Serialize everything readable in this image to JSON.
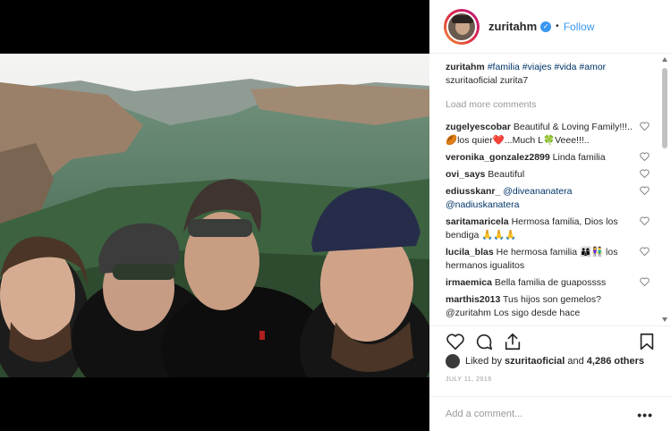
{
  "post": {
    "username": "zuritahm",
    "follow_label": "Follow",
    "dot": "•",
    "verified_mark": "✓",
    "photo_alt": "Family selfie at a mountain overlook"
  },
  "caption": {
    "username": "zuritahm",
    "tags": "#familia #viajes #vida #amor",
    "text": "szuritaoficial zurita7"
  },
  "load_more": "Load more comments",
  "comments": [
    {
      "username": "zugelyescobar",
      "text": "Beautiful & Loving Family!!!..🏉los quier❤️...Much L🍀Veee!!!.."
    },
    {
      "username": "veronika_gonzalez2899",
      "text": "Linda familia"
    },
    {
      "username": "ovi_says",
      "text": "Beautiful"
    },
    {
      "username": "ediusskanr_",
      "text": "@diveananatera @nadiuskanatera"
    },
    {
      "username": "saritamaricela",
      "text": "Hermosa familia, Dios los bendiga 🙏🙏🙏"
    },
    {
      "username": "lucila_blas",
      "text": "He hermosa familia 👨‍👩‍👦👫 los hermanos igualitos"
    },
    {
      "username": "irmaemica",
      "text": "Bella familia de guapossss"
    },
    {
      "username": "marthis2013",
      "text": "Tus hijos son gemelos? @zuritahm Los sigo desde hace"
    }
  ],
  "likes": {
    "prefix": "Liked by",
    "user": "szuritaoficial",
    "conj": "and",
    "count": "4,286 others"
  },
  "date": "JULY 11, 2016",
  "add_comment_placeholder": "Add a comment...",
  "more_label": "•••",
  "icons": {
    "like": "heart-icon",
    "comment": "comment-icon",
    "share": "share-icon",
    "save": "bookmark-icon"
  },
  "colors": {
    "link": "#3897f0",
    "muted": "#999999",
    "text": "#262626"
  }
}
